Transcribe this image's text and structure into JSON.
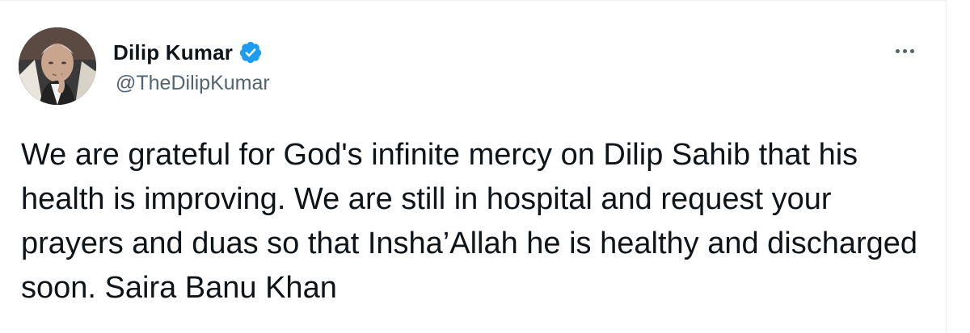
{
  "tweet": {
    "author": {
      "display_name": "Dilip Kumar",
      "handle": "@TheDilipKumar",
      "verified": true
    },
    "text": "We are grateful for God's infinite mercy on Dilip Sahib that his health is improving. We are still in hospital and request your prayers and duas so that Insha’Allah he is healthy and discharged  soon. Saira Banu Khan",
    "icons": {
      "verified": "verified-badge-icon",
      "more": "more-options-icon"
    },
    "colors": {
      "verified_badge": "#1d9bf0",
      "handle_text": "#536471",
      "body_text": "#0f1419"
    }
  }
}
